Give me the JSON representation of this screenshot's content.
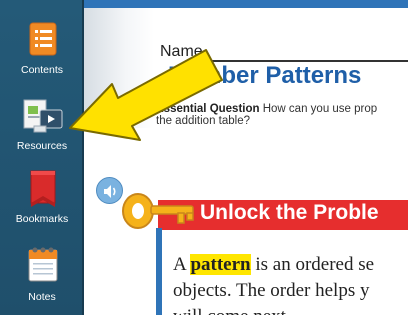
{
  "sidebar": {
    "items": [
      {
        "label": "Contents",
        "icon": "contents-icon"
      },
      {
        "label": "Resources",
        "icon": "resources-icon"
      },
      {
        "label": "Bookmarks",
        "icon": "bookmark-icon"
      },
      {
        "label": "Notes",
        "icon": "notes-icon"
      }
    ]
  },
  "lesson": {
    "name_label": "Name",
    "title": "Number Patterns",
    "essential_question_label": "Essential Question",
    "essential_question_text": "How can you use prop",
    "essential_question_text_line2": "the addition table?",
    "section_heading": "Unlock the Proble",
    "body_line1_highlight": "pattern",
    "body_line1_rest": " is an ordered se",
    "body_line1_lead": "A ",
    "body_line2": "objects. The order helps y",
    "body_line3": "will come next."
  },
  "colors": {
    "sidebar": "#245a78",
    "title_blue": "#1f5fa8",
    "unlock_red": "#e62e2e",
    "arrow_yellow": "#ffe100",
    "highlight": "#ffe600"
  }
}
